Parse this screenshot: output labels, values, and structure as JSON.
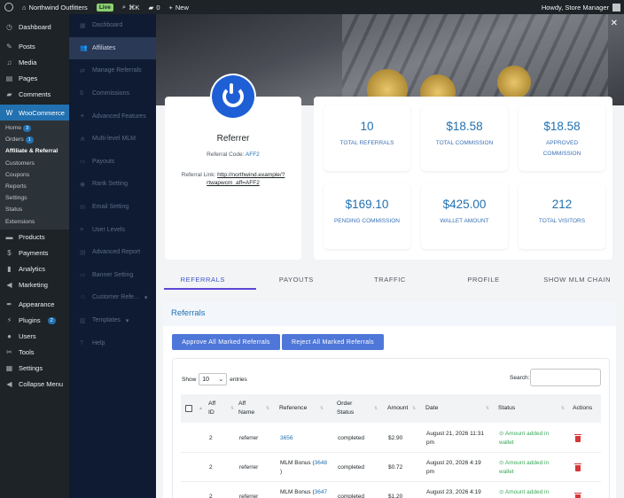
{
  "admin_bar": {
    "site_name": "Northwind Outfitters",
    "live_badge": "Live",
    "search_shortcut": "⌘K",
    "comments_count": "0",
    "new_label": "New",
    "greeting": "Howdy, Store Manager"
  },
  "sidebar": {
    "items_top": [
      {
        "label": "Dashboard",
        "icon": "dashboard-icon"
      },
      {
        "label": "Posts",
        "icon": "pin-icon"
      },
      {
        "label": "Media",
        "icon": "media-icon"
      },
      {
        "label": "Pages",
        "icon": "page-icon"
      },
      {
        "label": "Comments",
        "icon": "comment-icon"
      }
    ],
    "woocommerce": "WooCommerce",
    "submenu": [
      {
        "label": "Home",
        "badge": "3"
      },
      {
        "label": "Orders",
        "badge": "1"
      },
      {
        "label": "Affiliate & Referral",
        "badge": ""
      },
      {
        "label": "Customers",
        "badge": ""
      },
      {
        "label": "Coupons",
        "badge": ""
      },
      {
        "label": "Reports",
        "badge": ""
      },
      {
        "label": "Settings",
        "badge": ""
      },
      {
        "label": "Status",
        "badge": ""
      },
      {
        "label": "Extensions",
        "badge": ""
      }
    ],
    "items_bottom": [
      {
        "label": "Products",
        "badge": ""
      },
      {
        "label": "Payments",
        "badge": ""
      },
      {
        "label": "Analytics",
        "badge": ""
      },
      {
        "label": "Marketing",
        "badge": ""
      },
      {
        "label": "Appearance",
        "badge": ""
      },
      {
        "label": "Plugins",
        "badge": "2"
      },
      {
        "label": "Users",
        "badge": ""
      },
      {
        "label": "Tools",
        "badge": ""
      },
      {
        "label": "Settings",
        "badge": ""
      },
      {
        "label": "Collapse Menu",
        "badge": ""
      }
    ]
  },
  "plugin_nav": [
    "Dashboard",
    "Affiliates",
    "Manage Referrals",
    "Commissions",
    "Advanced Features",
    "Multi-level MLM",
    "Payouts",
    "Rank Setting",
    "Email Setting",
    "User Levels",
    "Advanced Report",
    "Banner Setting",
    "Customer Refe...",
    "Templates",
    "Help"
  ],
  "profile": {
    "name": "Referrer",
    "code_label": "Referral Code:",
    "code": "AFF2",
    "link_label": "Referral Link:",
    "link_line1": "http://northwind.example/?",
    "link_line2": "rtwapwcm_aff=AFF2"
  },
  "stats": [
    {
      "value": "10",
      "label": "TOTAL REFERRALS"
    },
    {
      "value": "$18.58",
      "label": "TOTAL COMMISSION"
    },
    {
      "value": "$18.58",
      "label": "APPROVED COMMISSION"
    },
    {
      "value": "$169.10",
      "label": "PENDING COMMISSION"
    },
    {
      "value": "$425.00",
      "label": "WALLET AMOUNT"
    },
    {
      "value": "212",
      "label": "TOTAL VISITORS"
    }
  ],
  "tabs": [
    "REFERRALS",
    "PAYOUTS",
    "TRAFFIC",
    "PROFILE",
    "SHOW MLM CHAIN"
  ],
  "panel": {
    "title": "Referrals",
    "approve_btn": "Approve All Marked Referrals",
    "reject_btn": "Reject All Marked Referrals",
    "show_label": "Show",
    "entries_value": "10",
    "entries_label": "entries",
    "search_label": "Search:"
  },
  "table": {
    "headers": {
      "aff_id": [
        "Aff",
        "ID"
      ],
      "aff_name": [
        "Aff",
        "Name"
      ],
      "reference": "Reference",
      "order_status": [
        "Order",
        "Status"
      ],
      "amount": "Amount",
      "date": "Date",
      "status": "Status",
      "actions": "Actions"
    },
    "rows": [
      {
        "aff_id": "2",
        "aff_name": "referrer",
        "ref_prefix": "",
        "ref_link": "3656",
        "ref_suffix": "",
        "order_status": "completed",
        "amount": "$2.90",
        "date1": "August 21, 2026 11:31",
        "date2": "pm",
        "status1": "Amount added in",
        "status2": "wallet"
      },
      {
        "aff_id": "2",
        "aff_name": "referrer",
        "ref_prefix": "MLM Bonus (",
        "ref_link": "3648",
        "ref_suffix": ")",
        "order_status": "completed",
        "amount": "$0.72",
        "date1": "August 20, 2026 4:19",
        "date2": "pm",
        "status1": "Amount added in",
        "status2": "wallet"
      },
      {
        "aff_id": "2",
        "aff_name": "referrer",
        "ref_prefix": "MLM Bonus (",
        "ref_link": "3647",
        "ref_suffix": ")",
        "order_status": "completed",
        "amount": "$1.20",
        "date1": "August 23, 2026 4:19",
        "date2": "pm",
        "status1": "Amount added in",
        "status2": "wallet"
      }
    ]
  },
  "colors": {
    "accent": "#2271b1",
    "brand_blue": "#1f5fd6",
    "button": "#4f77d9",
    "success": "#3aa85a",
    "danger": "#d63638"
  }
}
